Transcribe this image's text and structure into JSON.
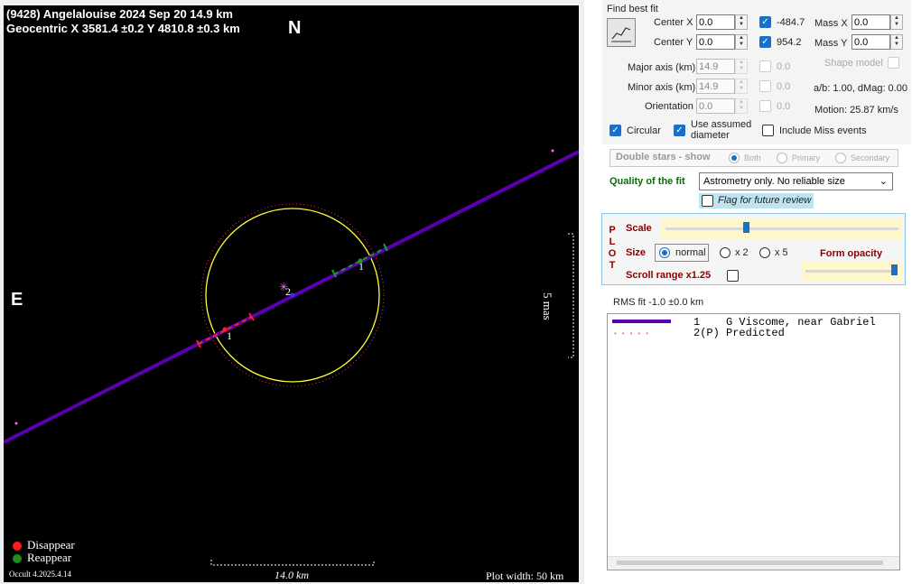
{
  "plot": {
    "header_line1": "(9428) Angelalouise  2024 Sep 20  14.9 km",
    "header_line2": "Geocentric  X  3581.4 ±0.2  Y 4810.8 ±0.3 km",
    "north_label": "N",
    "east_label": "E",
    "scale_mas_label": "5 mas",
    "chord_labels": [
      "1",
      "1",
      "2"
    ],
    "legend_disappear": "Disappear",
    "legend_reappear": "Reappear",
    "version": "Occult 4.2025.4.14",
    "scale_km_label": "14.0 km",
    "plot_width": "Plot width: 50 km",
    "colors": {
      "chord": "#5a00b0",
      "disappear": "#ff0000",
      "reappear": "#1e8c1e",
      "ellipse": "#ffff33"
    }
  },
  "panel": {
    "find_best_fit": "Find best fit",
    "center_x_label": "Center X",
    "center_x": "0.0",
    "center_y_label": "Center Y",
    "center_y": "0.0",
    "fit_x_value": "-484.7",
    "fit_y_value": "954.2",
    "mass_x_label": "Mass X",
    "mass_x": "0.0",
    "mass_y_label": "Mass Y",
    "mass_y": "0.0",
    "major_axis_label": "Major axis (km)",
    "major_axis": "14.9",
    "minor_axis_label": "Minor axis (km)",
    "minor_axis": "14.9",
    "orientation_label": "Orientation",
    "orientation": "0.0",
    "zero1": "0.0",
    "zero2": "0.0",
    "zero3": "0.0",
    "shape_model": "Shape model",
    "ab_dmag": "a/b: 1.00, dMag: 0.00",
    "motion": "Motion: 25.87 km/s",
    "circular": "Circular",
    "use_assumed_1": "Use assumed",
    "use_assumed_2": "diameter",
    "include_miss": "Include Miss events",
    "double_stars": "Double stars - show",
    "ds_both": "Both",
    "ds_primary": "Primary",
    "ds_secondary": "Secondary",
    "quality_label": "Quality of the fit",
    "quality_value": "Astrometry only. No reliable size",
    "flag_review": "Flag for future review",
    "plot_letters": [
      "P",
      "L",
      "O",
      "T"
    ],
    "scale_label": "Scale",
    "size_label": "Size",
    "size_normal": "normal",
    "size_x2": "x 2",
    "size_x5": "x 5",
    "form_opacity": "Form opacity",
    "scroll_range": "Scroll range x1.25",
    "rms_fit": "RMS fit -1.0 ±0.0 km",
    "legend_rows": [
      {
        "num": "1",
        "text": "G Viscome, near Gabriel"
      },
      {
        "num": "2(P)",
        "text": "Predicted"
      }
    ]
  }
}
